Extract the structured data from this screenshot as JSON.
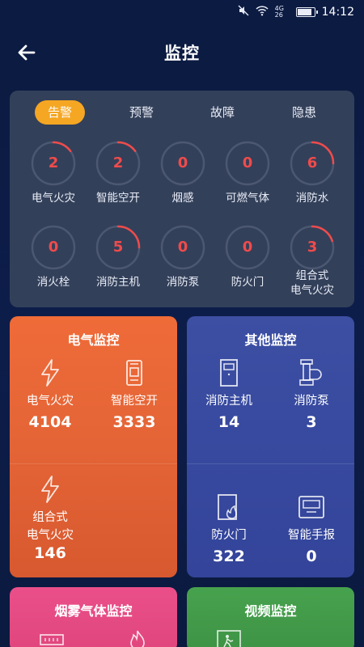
{
  "status_bar": {
    "network": "4G 26",
    "time": "14:12"
  },
  "header": {
    "title": "监控",
    "back_icon": "back-arrow-icon"
  },
  "alarm_tabs": [
    {
      "label": "告警",
      "active": true
    },
    {
      "label": "预警",
      "active": false
    },
    {
      "label": "故障",
      "active": false
    },
    {
      "label": "隐患",
      "active": false
    }
  ],
  "gauges": [
    {
      "label": "电气火灾",
      "value": "2",
      "level": 0.15
    },
    {
      "label": "智能空开",
      "value": "2",
      "level": 0.15
    },
    {
      "label": "烟感",
      "value": "0",
      "level": 0
    },
    {
      "label": "可燃气体",
      "value": "0",
      "level": 0
    },
    {
      "label": "消防水",
      "value": "6",
      "level": 0.25
    },
    {
      "label": "消火栓",
      "value": "0",
      "level": 0
    },
    {
      "label": "消防主机",
      "value": "5",
      "level": 0.25
    },
    {
      "label": "消防泵",
      "value": "0",
      "level": 0
    },
    {
      "label": "防火门",
      "value": "0",
      "level": 0
    },
    {
      "label": "组合式\n电气火灾",
      "value": "3",
      "level": 0.2
    }
  ],
  "electric_card": {
    "title": "电气监控",
    "items": [
      {
        "label": "电气火灾",
        "value": "4104",
        "icon": "lightning-icon"
      },
      {
        "label": "智能空开",
        "value": "3333",
        "icon": "smart-breaker-icon"
      },
      {
        "label": "组合式\n电气火灾",
        "value": "146",
        "icon": "lightning-icon"
      }
    ]
  },
  "other_card": {
    "title": "其他监控",
    "items": [
      {
        "label": "消防主机",
        "value": "14",
        "icon": "fire-host-icon"
      },
      {
        "label": "消防泵",
        "value": "3",
        "icon": "fire-pump-icon"
      },
      {
        "label": "防火门",
        "value": "322",
        "icon": "fire-door-icon"
      },
      {
        "label": "智能手报",
        "value": "0",
        "icon": "manual-alarm-icon"
      }
    ]
  },
  "smoke_card": {
    "title": "烟雾气体监控"
  },
  "video_card": {
    "title": "视频监控"
  },
  "colors": {
    "accent": "#f5a623",
    "alarm_red": "#f04b4b",
    "panel": "#33405a"
  }
}
